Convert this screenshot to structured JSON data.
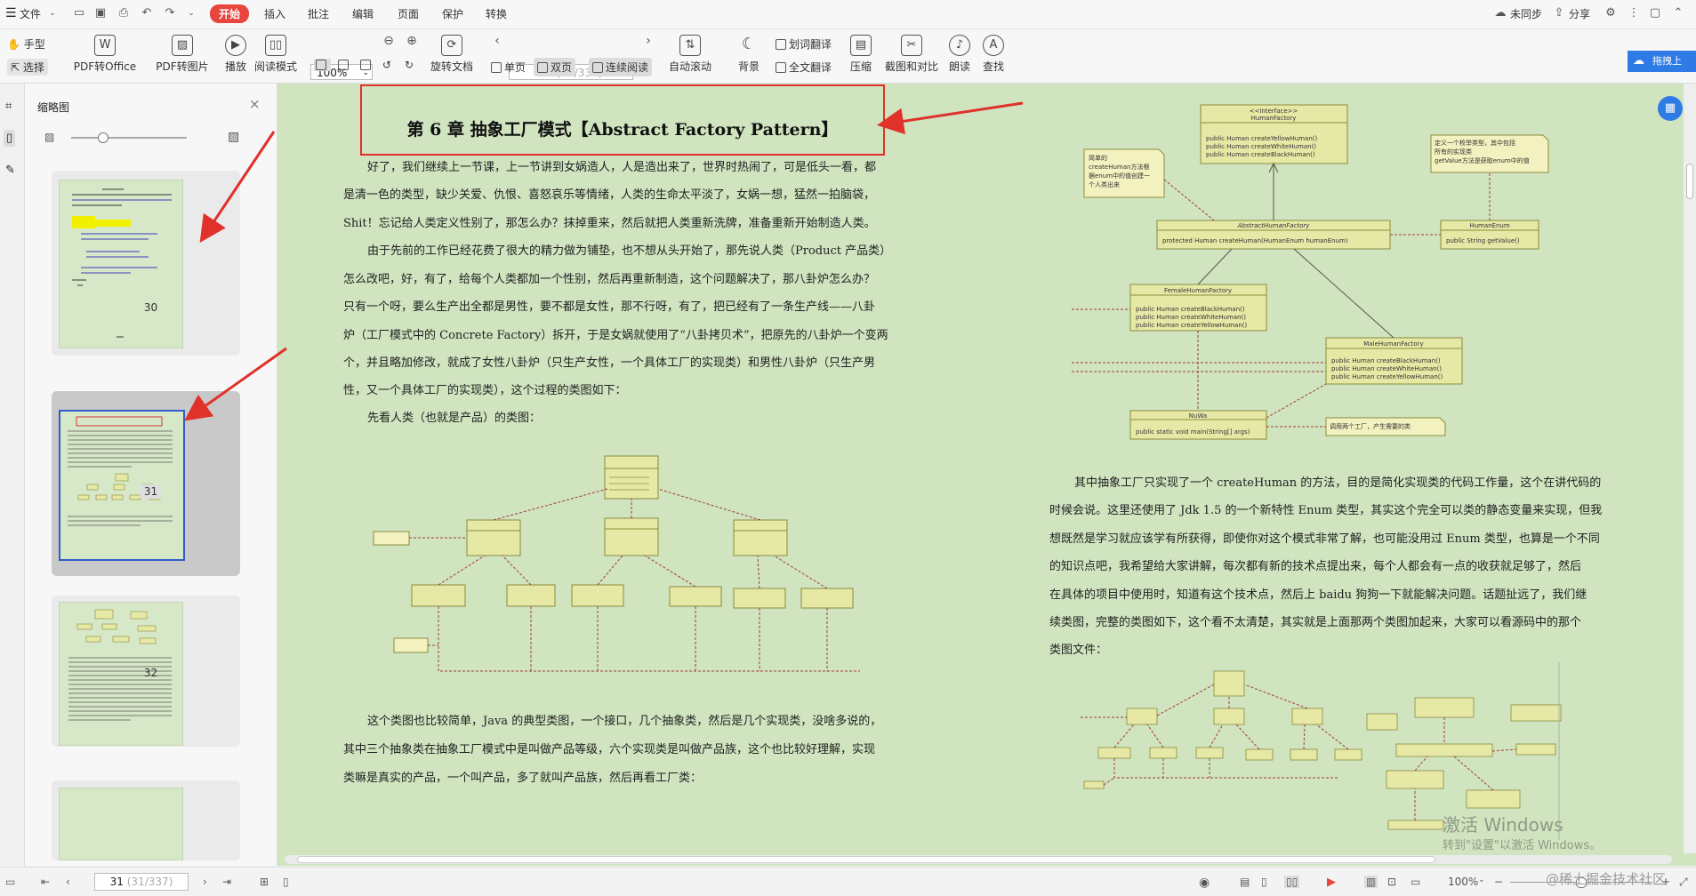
{
  "menubar": {
    "file_label": "文件",
    "tabs": [
      "开始",
      "插入",
      "批注",
      "编辑",
      "页面",
      "保护",
      "转换"
    ],
    "active_tab": "开始",
    "unsynced_label": "未同步",
    "share_label": "分享"
  },
  "ribbon": {
    "hand_label": "手型",
    "select_label": "选择",
    "pdf_to_office_label": "PDF转Office",
    "pdf_to_image_label": "PDF转图片",
    "play_label": "播放",
    "read_mode_label": "阅读模式",
    "zoom_value": "100%",
    "rotate_label": "旋转文档",
    "single_page_label": "单页",
    "double_page_label": "双页",
    "continuous_label": "连续阅读",
    "page_current": "31",
    "page_total": "(31/337)",
    "auto_scroll_label": "自动滚动",
    "background_label": "背景",
    "word_translate_label": "划词翻译",
    "full_translate_label": "全文翻译",
    "compress_label": "压缩",
    "screenshot_compare_label": "截图和对比",
    "read_aloud_label": "朗读",
    "find_label": "查找",
    "right_button_label": "拖拽上"
  },
  "thumbnail_panel": {
    "title": "缩略图",
    "pages": [
      {
        "number": "30"
      },
      {
        "number": "31"
      },
      {
        "number": "32"
      }
    ]
  },
  "document": {
    "chapter_title": "第 6 章   抽象工厂模式【Abstract Factory Pattern】",
    "left_paragraphs": [
      "好了，我们继续上一节课，上一节讲到女娲造人，人是造出来了，世界时热闹了，可是低头一看，都",
      "是清一色的类型，缺少关爱、仇恨、喜怒哀乐等情绪，人类的生命太平淡了，女娲一想，猛然一拍脑袋，",
      "Shit！忘记给人类定义性别了，那怎么办？抹掉重来，然后就把人类重新洗牌，准备重新开始制造人类。",
      "由于先前的工作已经花费了很大的精力做为铺垫，也不想从头开始了，那先说人类（Product 产品类）",
      "怎么改吧，好，有了，给每个人类都加一个性别，然后再重新制造，这个问题解决了，那八卦炉怎么办？",
      "只有一个呀，要么生产出全都是男性，要不都是女性，那不行呀，有了，把已经有了一条生产线——八卦",
      "炉（工厂模式中的 Concrete Factory）拆开，于是女娲就使用了“八卦拷贝术”，把原先的八卦炉一个变两",
      "个，并且略加修改，就成了女性八卦炉（只生产女性，一个具体工厂的实现类）和男性八卦炉（只生产男",
      "性，又一个具体工厂的实现类），这个过程的类图如下：",
      "先看人类（也就是产品）的类图："
    ],
    "left_bottom_paragraphs": [
      "这个类图也比较简单，Java 的典型类图，一个接口，几个抽象类，然后是几个实现类，没啥多说的，",
      "其中三个抽象类在抽象工厂模式中是叫做产品等级，六个实现类是叫做产品族，这个也比较好理解，实现",
      "类嘛是真实的产品，一个叫产品，多了就叫产品族，然后再看工厂类："
    ],
    "right_paragraphs": [
      "其中抽象工厂只实现了一个 createHuman 的方法，目的是简化实现类的代码工作量，这个在讲代码的",
      "时候会说。这里还使用了 Jdk 1.5 的一个新特性 Enum 类型，其实这个完全可以类的静态变量来实现，但我",
      "想既然是学习就应该学有所获得，即使你对这个模式非常了解，也可能没用过 Enum 类型，也算是一个不同",
      "的知识点吧，我希望给大家讲解，每次都有新的技术点提出来，每个人都会有一点的收获就足够了，然后",
      "在具体的项目中使用时，知道有这个技术点，然后上 baidu 狗狗一下就能解决问题。话题扯远了，我们继",
      "续类图，完整的类图如下，这个看不太清楚，其实就是上面那两个类图加起来，大家可以看源码中的那个",
      "类图文件："
    ],
    "uml_factory": {
      "interface_stereotype": "<<Interface>>",
      "interface_name": "HumanFactory",
      "interface_methods": [
        "public Human createYellowHuman()",
        "public Human createWhiteHuman()",
        "public Human createBlackHuman()"
      ],
      "abstract_name": "AbstractHumanFactory",
      "abstract_method": "protected Human createHuman(HumanEnum humanEnum)",
      "enum_name": "HumanEnum",
      "enum_method": "public String getValue()",
      "female_name": "FemaleHumanFactory",
      "female_methods": [
        "public Human createBlackHuman()",
        "public Human createWhiteHuman()",
        "public Human createYellowHuman()"
      ],
      "male_name": "MaleHumanFactory",
      "male_methods": [
        "public Human createBlackHuman()",
        "public Human createWhiteHuman()",
        "public Human createYellowHuman()"
      ],
      "nuwa_name": "NuWa",
      "nuwa_method": "public static void main(String[] args)",
      "note_left": [
        "简单的",
        "createHuman方法根",
        "据enum中的值创建一",
        "个人类出来"
      ],
      "note_right": [
        "定义一个枚举类型，其中包括",
        "所有的实现类",
        "getValue方法是获取enum中的值"
      ],
      "note_bottom": "调用两个工厂，产生需要的类"
    }
  },
  "statusbar": {
    "page_current": "31",
    "page_total": "(31/337)",
    "zoom_value": "100%"
  },
  "watermarks": {
    "activate_title": "激活 Windows",
    "activate_sub": "转到\"设置\"以激活 Windows。",
    "site": "@稀土掘金技术社区"
  },
  "colors": {
    "accent": "#e8453c",
    "page_bg": "#cfe4bf",
    "highlight_box": "#e0312b"
  }
}
